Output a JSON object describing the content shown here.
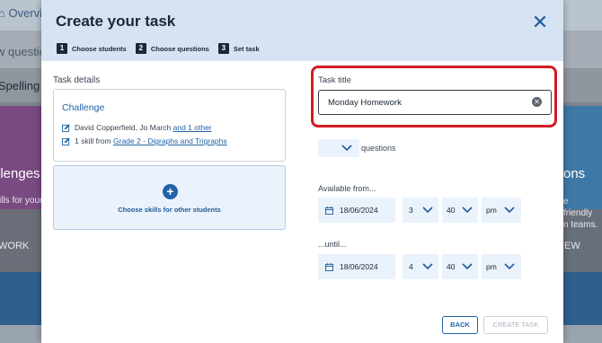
{
  "background": {
    "overview": "Overvie",
    "questions": "w questio",
    "spelling": "Spelling",
    "left_card": {
      "heading": "llenges",
      "text": "ills for your",
      "cta": "WORK"
    },
    "right_card": {
      "heading": "ons",
      "text": "e friendly n teams.",
      "cta": "EW"
    }
  },
  "modal": {
    "title": "Create your task",
    "steps": [
      {
        "num": "1",
        "label": "Choose students"
      },
      {
        "num": "2",
        "label": "Choose questions"
      },
      {
        "num": "3",
        "label": "Set task"
      }
    ],
    "task_details": {
      "label": "Task details",
      "challenge_title": "Challenge",
      "students_prefix": "David Copperfield, Jo March",
      "students_link": "and 1 other",
      "skill_prefix": "1 skill from",
      "skill_link": "Grade 2 - Digraphs and Trigraphs",
      "choose_skills": "Choose skills for other students"
    },
    "task_title": {
      "label": "Task title",
      "value": "Monday Homework"
    },
    "questions_label": "questions",
    "available_from": {
      "label": "Available from...",
      "date": "18/06/2024",
      "hour": "3",
      "minute": "40",
      "ampm": "pm"
    },
    "until": {
      "label": "...until...",
      "date": "18/06/2024",
      "hour": "4",
      "minute": "40",
      "ampm": "pm"
    },
    "buttons": {
      "back": "BACK",
      "create": "CREATE TASK"
    }
  },
  "colors": {
    "accent": "#2064a6",
    "highlight": "#d21c24",
    "header_bg": "#d5e3f3",
    "field_bg": "#eaf2fb"
  }
}
